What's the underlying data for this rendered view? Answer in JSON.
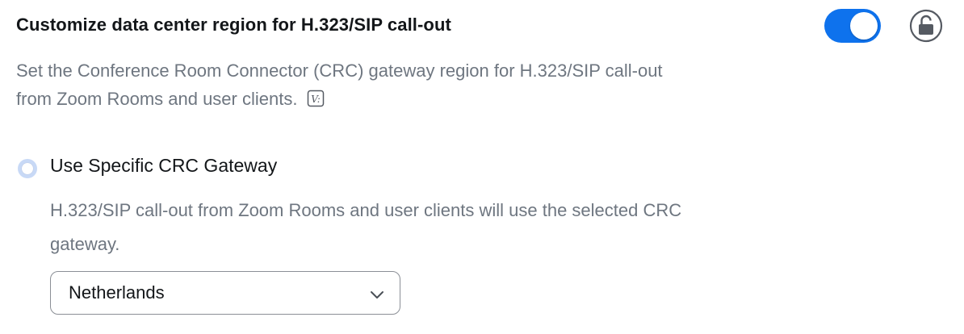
{
  "setting": {
    "title": "Customize data center region for H.323/SIP call-out",
    "enabled": true,
    "description_line1": "Set the Conference Room Connector (CRC) gateway region for H.323/SIP call-out",
    "description_line2": "from Zoom Rooms and user clients."
  },
  "option": {
    "label": "Use Specific CRC Gateway",
    "description_line1": "H.323/SIP call-out from Zoom Rooms and user clients will use the selected CRC",
    "description_line2": "gateway."
  },
  "region_select": {
    "value": "Netherlands"
  },
  "icons": {
    "lock": "unlock-icon",
    "version": "version-tag-icon",
    "chevron": "chevron-down-icon"
  },
  "colors": {
    "accent": "#0e72ed",
    "muted_text": "#6e7680",
    "radio_fill": "#c8d9f6"
  }
}
